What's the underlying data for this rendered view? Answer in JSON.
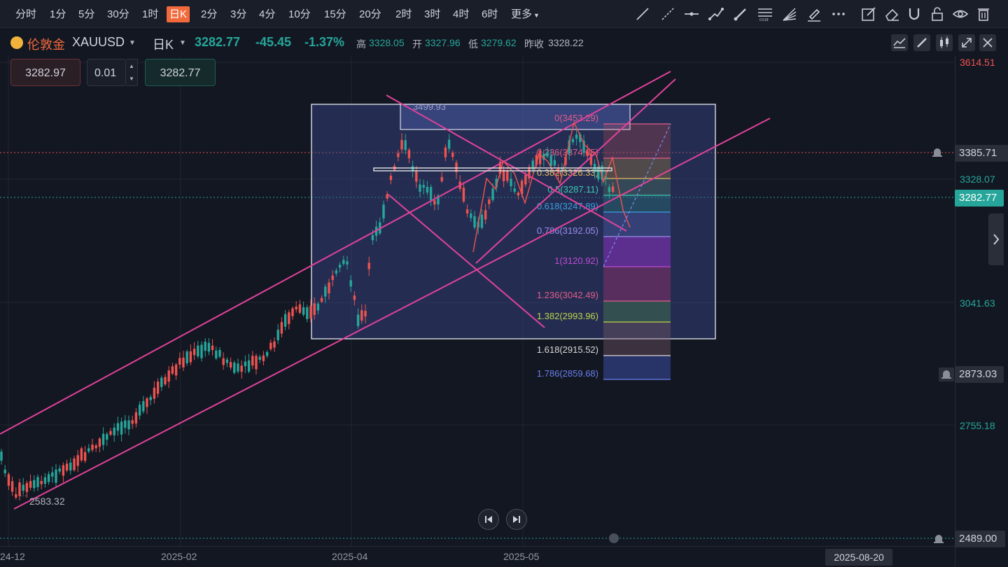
{
  "toolbar": {
    "timeframes": [
      "分时",
      "1分",
      "5分",
      "30分",
      "1时",
      "日K",
      "2分",
      "3分",
      "4分",
      "10分",
      "15分",
      "20分",
      "2时",
      "3时",
      "4时",
      "6时",
      "更多"
    ],
    "active_timeframe": "日K",
    "drawing_tools": [
      "trend-line-icon",
      "ray-icon",
      "horizontal-line-icon",
      "path-icon",
      "brush-icon",
      "fib-retracement-icon",
      "fan-icon",
      "highlighter-icon",
      "more-dots-icon",
      "edit-icon",
      "eraser-icon",
      "magnet-icon",
      "lock-icon",
      "eye-icon",
      "trash-icon"
    ]
  },
  "symbol": {
    "name": "伦敦金",
    "code": "XAUUSD",
    "period": "日K",
    "price": "3282.77",
    "change": "-45.45",
    "change_pct": "-1.37%",
    "high_label": "高",
    "high": "3328.05",
    "open_label": "开",
    "open": "3327.96",
    "low_label": "低",
    "low": "3279.62",
    "prev_close_label": "昨收",
    "prev_close": "3328.22"
  },
  "trade": {
    "sell_price": "3282.97",
    "lot": "0.01",
    "buy_price": "3282.77"
  },
  "yaxis": {
    "labels": [
      "3614.51",
      "3328.07",
      "3041.63",
      "2755.18"
    ],
    "tags": {
      "alert_high": "3385.71",
      "current": "3282.77",
      "alert_mid": "2873.03",
      "alert_low": "2489.00"
    }
  },
  "xaxis": {
    "labels": [
      "24-12",
      "2025-02",
      "2025-04",
      "2025-05"
    ],
    "cursor_date": "2025-08-20"
  },
  "annotations": {
    "box_top": "3499.93",
    "low_point": "2583.32"
  },
  "fib_levels": [
    {
      "label": "0(3453.29)",
      "color": "#e25b8a"
    },
    {
      "label": "0.236(3374.05)",
      "color": "#e25b8a"
    },
    {
      "label": "0.382(3326.33)",
      "color": "#e4b85c"
    },
    {
      "label": "0.5(3287.11)",
      "color": "#3dc9b0"
    },
    {
      "label": "0.618(3247.89)",
      "color": "#3aa0e0"
    },
    {
      "label": "0.786(3192.05)",
      "color": "#9a8cf0"
    },
    {
      "label": "1(3120.92)",
      "color": "#c04ad8"
    },
    {
      "label": "1.236(3042.49)",
      "color": "#e25b8a"
    },
    {
      "label": "1.382(2993.96)",
      "color": "#bcd44a"
    },
    {
      "label": "1.618(2915.52)",
      "color": "#d8d8d8"
    },
    {
      "label": "1.786(2859.68)",
      "color": "#6a7ff0"
    }
  ],
  "colors": {
    "up": "#26a69a",
    "down": "#ef5350",
    "accent": "#f26a3c",
    "channel": "#e0429a"
  }
}
